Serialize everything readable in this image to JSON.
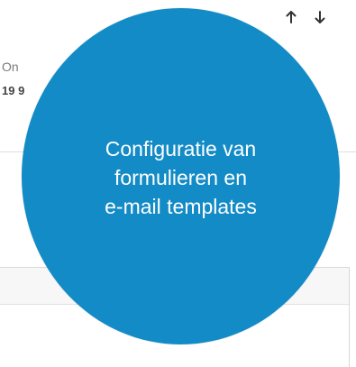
{
  "toolbar": {
    "up_icon": "arrow-up-icon",
    "down_icon": "arrow-down-icon"
  },
  "row": {
    "label": "On",
    "value": "19 9"
  },
  "overlay": {
    "color": "#138bc6",
    "lines": [
      "Configuratie van",
      "formulieren en",
      "e-mail templates"
    ]
  }
}
